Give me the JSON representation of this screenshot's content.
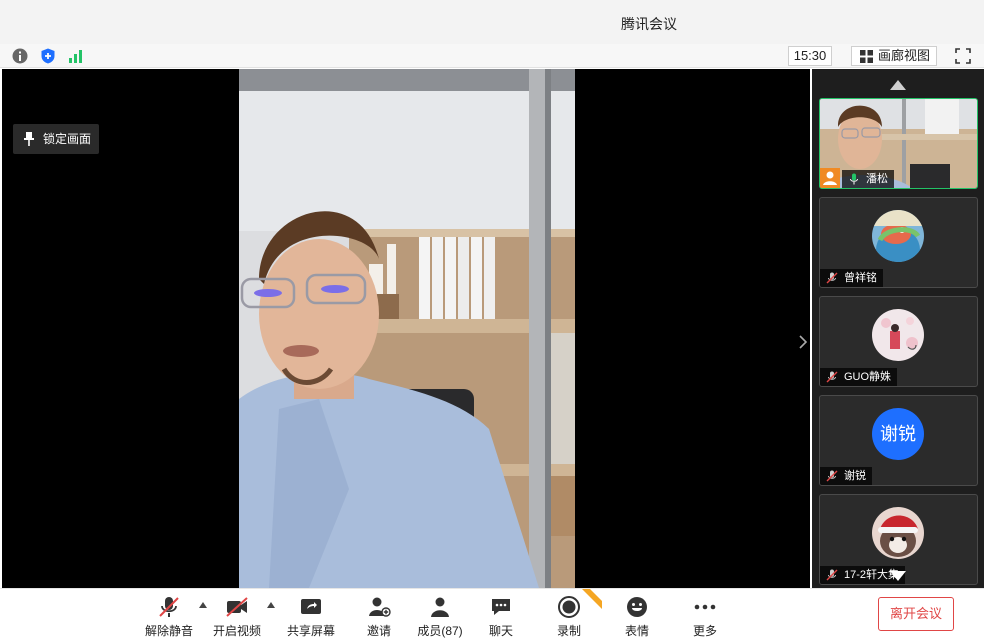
{
  "window": {
    "title": "腾讯会议"
  },
  "toolbar": {
    "info_icon": "info-icon",
    "shield_icon": "shield-icon",
    "signal_icon": "signal-icon",
    "time": "15:30",
    "gallery_label": "画廊视图",
    "fullscreen_icon": "fullscreen-icon"
  },
  "main": {
    "lock_label": "锁定画面"
  },
  "participants": [
    {
      "name": "潘松",
      "active": true,
      "host": true,
      "mic": "on"
    },
    {
      "name": "曾祥铭",
      "active": false,
      "mic": "muted"
    },
    {
      "name": "GUO静姝",
      "active": false,
      "mic": "muted"
    },
    {
      "name": "谢锐",
      "active": false,
      "mic": "muted",
      "avatar_text": "谢锐",
      "avatar_color": "#1e6fff"
    },
    {
      "name": "17-2轩大集",
      "active": false,
      "mic": "muted"
    }
  ],
  "controls": {
    "unmute": "解除静音",
    "start_video": "开启视频",
    "share_screen": "共享屏幕",
    "invite": "邀请",
    "members": "成员(87)",
    "chat": "聊天",
    "record": "录制",
    "reactions": "表情",
    "more": "更多",
    "leave": "离开会议"
  },
  "colors": {
    "accent_green": "#23c367",
    "leave_red": "#e04646",
    "avatar_blue": "#1e6fff",
    "host_orange": "#f08a24"
  }
}
